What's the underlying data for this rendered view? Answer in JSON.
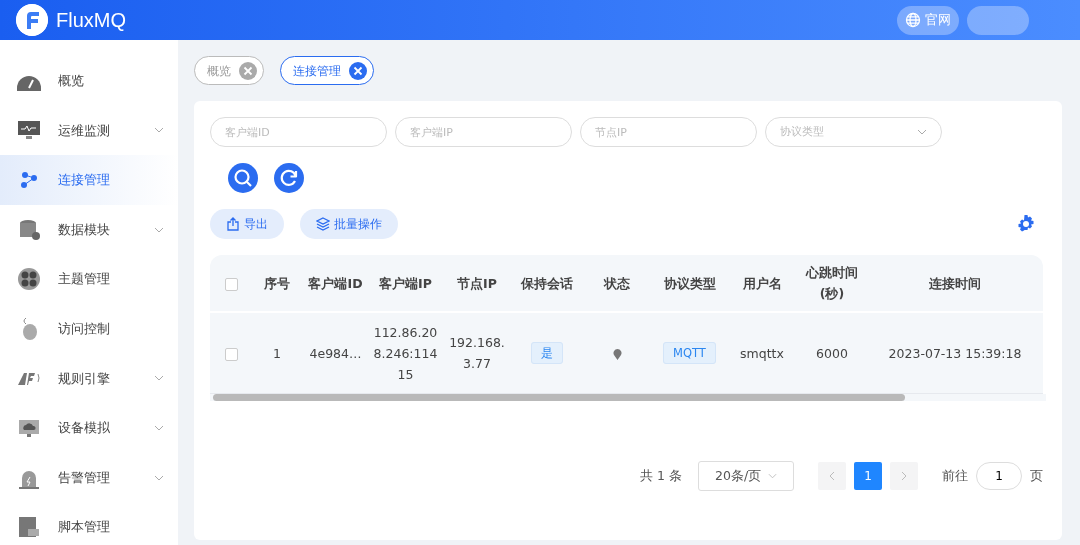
{
  "header": {
    "logo_text": "FluxMQ",
    "website_button": "官网"
  },
  "sidebar": {
    "items": [
      {
        "label": "概览",
        "selected": false,
        "expandable": false
      },
      {
        "label": "运维监测",
        "selected": false,
        "expandable": true
      },
      {
        "label": "连接管理",
        "selected": true,
        "expandable": false
      },
      {
        "label": "数据模块",
        "selected": false,
        "expandable": true
      },
      {
        "label": "主题管理",
        "selected": false,
        "expandable": false
      },
      {
        "label": "访问控制",
        "selected": false,
        "expandable": false
      },
      {
        "label": "规则引擎",
        "selected": false,
        "expandable": true
      },
      {
        "label": "设备模拟",
        "selected": false,
        "expandable": true
      },
      {
        "label": "告警管理",
        "selected": false,
        "expandable": true
      },
      {
        "label": "脚本管理",
        "selected": false,
        "expandable": false
      }
    ]
  },
  "tabs": [
    {
      "label": "概览",
      "selected": false
    },
    {
      "label": "连接管理",
      "selected": true
    }
  ],
  "filters": [
    {
      "placeholder": "客户端ID",
      "kind": "input"
    },
    {
      "placeholder": "客户端IP",
      "kind": "input"
    },
    {
      "placeholder": "节点IP",
      "kind": "input"
    },
    {
      "placeholder": "协议类型",
      "kind": "select"
    }
  ],
  "actions": [
    "导出",
    "批量操作"
  ],
  "table": {
    "select_all_checked": false,
    "columns": [
      "序号",
      "客户端ID",
      "客户端IP",
      "节点IP",
      "保持会话",
      "状态",
      "协议类型",
      "用户名",
      "心跳时间(秒)",
      "连接时间"
    ],
    "rows": [
      {
        "checked": false,
        "cells": [
          "1",
          "4e984…",
          "112.86.208.246:11415",
          "192.168.3.77",
          "是",
          "",
          "MQTT",
          "smqttx",
          "6000",
          "2023-07-13 15:39:18"
        ]
      }
    ]
  },
  "pagination": {
    "total": "共 1 条",
    "page_size": "20条/页",
    "pages": [
      {
        "label": "1",
        "selected": true
      }
    ],
    "goto_label": "前往",
    "goto_value": "1",
    "goto_suffix": "页"
  }
}
